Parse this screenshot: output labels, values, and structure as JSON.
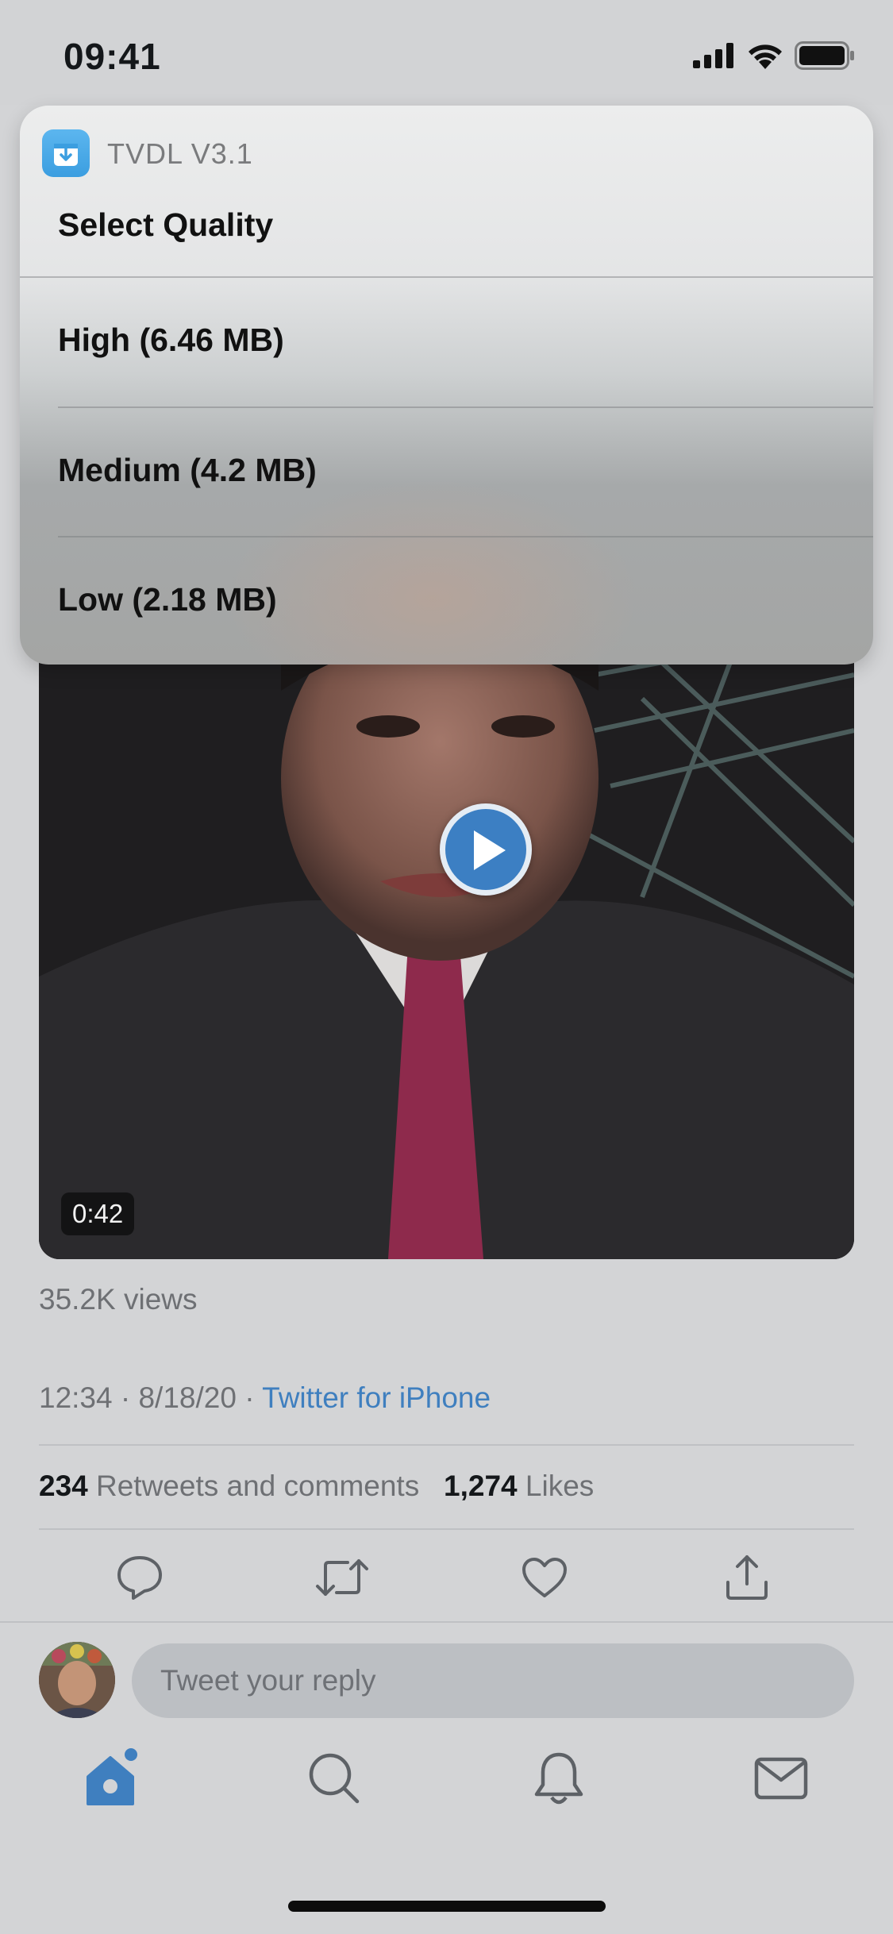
{
  "status_bar": {
    "time": "09:41"
  },
  "popup": {
    "app_name": "TVDL V3.1",
    "title": "Select Quality",
    "options": [
      {
        "label": "High (6.46 MB)"
      },
      {
        "label": "Medium (4.2 MB)"
      },
      {
        "label": "Low (2.18 MB)"
      }
    ]
  },
  "tweet": {
    "video_duration": "0:42",
    "views": "35.2K views",
    "timestamp": "12:34 · 8/18/20 · ",
    "source": "Twitter for iPhone",
    "retweets_count": "234",
    "retweets_label": " Retweets and comments",
    "likes_count": "1,274",
    "likes_label": " Likes"
  },
  "reply": {
    "placeholder": "Tweet your reply"
  },
  "colors": {
    "accent": "#3f7fbf",
    "play_button": "#3c7fc3",
    "app_icon": "#4aa8e8"
  },
  "icons": {
    "actions": [
      "reply-icon",
      "retweet-icon",
      "like-icon",
      "share-icon"
    ],
    "tabs": [
      "home-icon",
      "search-icon",
      "notifications-icon",
      "messages-icon"
    ]
  }
}
